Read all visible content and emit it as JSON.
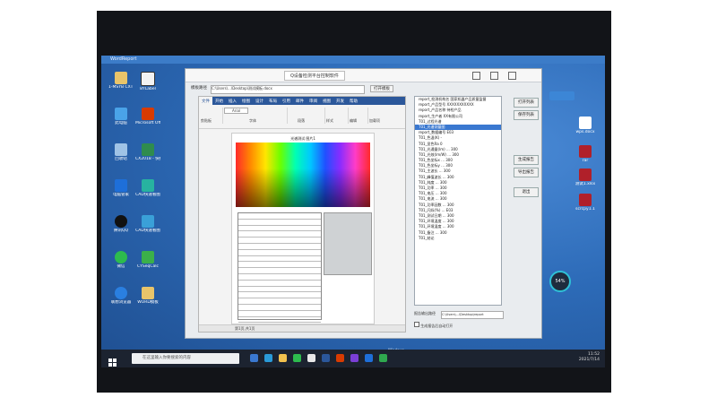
{
  "window": {
    "title": "Q设备检测平台控制软件",
    "file_label": "模板路径",
    "path": "C:\\Users\\...\\Desktop\\测试模板.docx",
    "open_button": "打开模板"
  },
  "word": {
    "tabs": [
      "文件",
      "开始",
      "插入",
      "绘图",
      "设计",
      "布局",
      "引用",
      "邮件",
      "审阅",
      "视图",
      "开发",
      "帮助",
      "格式",
      "设计",
      "布局"
    ],
    "active_tab": 1,
    "groups": [
      "剪贴板",
      "字体",
      "段落",
      "样式",
      "编辑",
      "语音",
      "加载项"
    ],
    "font": "Arial",
    "caption": "光谱测试 图片1"
  },
  "params": [
    {
      "text": "report_检测机构名   国家机器产品质量监督"
    },
    {
      "text": "report_产品型号      XXXXXXXXXXX"
    },
    {
      "text": "report_产品名称      待检产品"
    },
    {
      "text": "report_生产者        XX有限公司"
    },
    {
      "text": "T01_过程光谱"
    },
    {
      "text": "T01_光谱测量图"
    },
    {
      "text": "report_数据编号           E03"
    },
    {
      "text": "T01_色温(K)           -"
    },
    {
      "text": "T01_显色Ra             0"
    },
    {
      "text": "T01_光通量(lm)    ...  300"
    },
    {
      "text": "T01_光效(lm/W)    ...  300"
    },
    {
      "text": "T01_色坐标x      ...  300"
    },
    {
      "text": "T01_色坐标y      ...  300"
    },
    {
      "text": "T01_主波长       ...  300"
    },
    {
      "text": "T01_峰值波长     ...  300"
    },
    {
      "text": "T01_纯度         ...  300"
    },
    {
      "text": "T01_功率         ...  300"
    },
    {
      "text": "T01_电压         ...  300"
    },
    {
      "text": "T01_电流         ...  300"
    },
    {
      "text": "T01_功率因数     ...  300"
    },
    {
      "text": "T01_闪烁(%)         ...  E03"
    },
    {
      "text": "T01_测试日期     ...  300"
    },
    {
      "text": "T01_环境温度     ...  300"
    },
    {
      "text": "T01_环境湿度     ...  300"
    },
    {
      "text": "T01_备注         ...  300"
    },
    {
      "text": "T01_结论"
    }
  ],
  "selected_param_index": 5,
  "buttons": {
    "open": "打开列表",
    "save": "保存列表",
    "generate": "生成报告",
    "export": "导出报告",
    "exit": "退出"
  },
  "output": {
    "label": "报告输出路径",
    "path": "C:\\Users\\...\\Desktop\\report",
    "checkbox": "生成报告后自动打开"
  },
  "desktop_icons": [
    {
      "label": "1-MSYB CXT 设计用备..."
    },
    {
      "label": "BYLabel"
    },
    {
      "label": "此电脑"
    },
    {
      "label": "Microsoft Office"
    },
    {
      "label": "回收站"
    },
    {
      "label": "CX2018 - 快捷方式"
    },
    {
      "label": "电脑管家"
    },
    {
      "label": "CAD快速看图"
    },
    {
      "label": "腾讯QQ"
    },
    {
      "label": "CAD快速看图"
    },
    {
      "label": "微信"
    },
    {
      "label": "CYSeqCalc"
    },
    {
      "label": "联想浏览器"
    },
    {
      "label": "WORD模板"
    }
  ],
  "right_icons": [
    {
      "label": "wps.docx"
    },
    {
      "label": "rar"
    },
    {
      "label": "测试1.xlsx"
    },
    {
      "label": "scrcpy1.1"
    }
  ],
  "taskbar": {
    "search_placeholder": "在这里输入你要搜索的内容",
    "time": "11:52",
    "date": "2021/7/14",
    "gauge": "54%"
  },
  "status_text": "第1页,共1页"
}
